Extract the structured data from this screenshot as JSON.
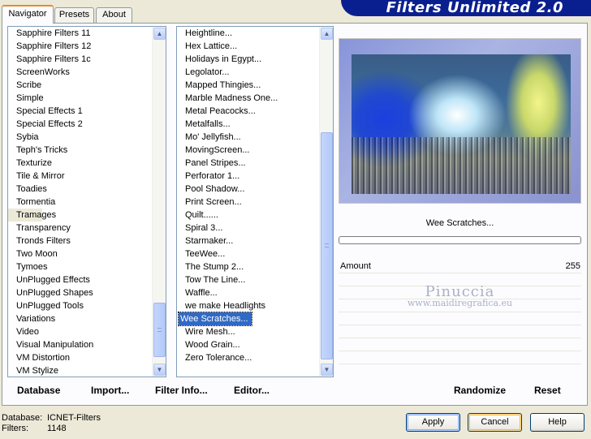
{
  "tabs": [
    {
      "label": "Navigator"
    },
    {
      "label": "Presets"
    },
    {
      "label": "About"
    }
  ],
  "app_title": "Filters Unlimited 2.0",
  "categories": [
    "Sapphire Filters 11",
    "Sapphire Filters 12",
    "Sapphire Filters 1c",
    "ScreenWorks",
    "Scribe",
    "Simple",
    "Special Effects 1",
    "Special Effects 2",
    "Sybia",
    "Teph's Tricks",
    "Texturize",
    "Tile & Mirror",
    "Toadies",
    "Tormentia",
    "Tramages",
    "Transparency",
    "Tronds Filters",
    "Two Moon",
    "Tymoes",
    "UnPlugged Effects",
    "UnPlugged Shapes",
    "UnPlugged Tools",
    "Variations",
    "Video",
    "Visual Manipulation",
    "VM Distortion",
    "VM Stylize"
  ],
  "selected_category": "Tramages",
  "filters": [
    "Heightline...",
    "Hex Lattice...",
    "Holidays in Egypt...",
    "Legolator...",
    "Mapped Thingies...",
    "Marble Madness One...",
    "Metal Peacocks...",
    "Metalfalls...",
    "Mo' Jellyfish...",
    "MovingScreen...",
    "Panel Stripes...",
    "Perforator 1...",
    "Pool Shadow...",
    "Print Screen...",
    "Quilt......",
    "Spiral 3...",
    "Starmaker...",
    "TeeWee...",
    "The Stump 2...",
    "Tow The Line...",
    "Waffle...",
    "we make Headlights",
    "Wee Scratches...",
    "Wire Mesh...",
    "Wood Grain...",
    "Zero Tolerance..."
  ],
  "selected_filter": "Wee Scratches...",
  "preview": {
    "filter_name": "Wee Scratches...",
    "progress": 0
  },
  "controls": [
    {
      "label": "Amount",
      "value": "255"
    }
  ],
  "watermark": {
    "name": "Pinuccia",
    "url": "www.maidiregrafica.eu"
  },
  "bottom_buttons": {
    "database": "Database",
    "import": "Import...",
    "filter_info": "Filter Info...",
    "editor": "Editor...",
    "randomize": "Randomize",
    "reset": "Reset"
  },
  "footer": {
    "database_label": "Database:",
    "database_value": "ICNET-Filters",
    "filters_label": "Filters:",
    "filters_value": "1148"
  },
  "dialog_buttons": {
    "apply": "Apply",
    "cancel": "Cancel",
    "help": "Help"
  }
}
